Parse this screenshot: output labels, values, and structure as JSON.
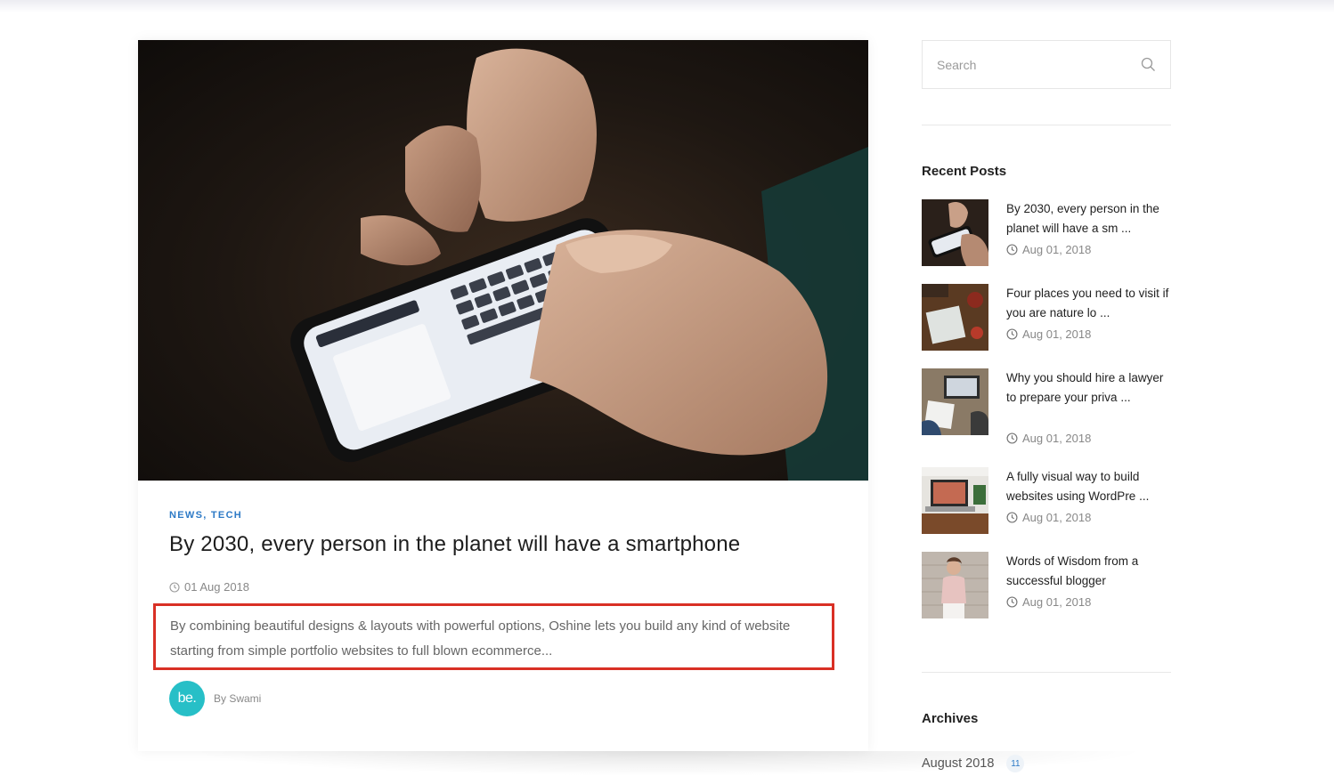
{
  "post": {
    "categories": "NEWS, TECH",
    "title": "By 2030, every person in the planet will have a smartphone",
    "date": "01 Aug 2018",
    "excerpt_line1": "By combining beautiful designs & layouts with powerful options, Oshine lets you build any kind of website",
    "excerpt_line2": "starting from simple portfolio websites to full blown ecommerce...",
    "author_avatar_text": "be.",
    "author": "By Swami",
    "image_icon": "hands-holding-smartphone-photo"
  },
  "sidebar": {
    "search": {
      "placeholder": "Search",
      "value": "",
      "icon": "search-icon"
    },
    "recent_posts_title": "Recent Posts",
    "recent_posts": [
      {
        "title": "By 2030, every person in the planet will have a sm ...",
        "date": "Aug 01, 2018",
        "thumb": "smartphone-photo"
      },
      {
        "title": "Four places you need to visit if you are nature lo ...",
        "date": "Aug 01, 2018",
        "thumb": "map-table-photo"
      },
      {
        "title": "Why you should hire a lawyer to prepare your priva ...",
        "date": "Aug 01, 2018",
        "thumb": "desk-laptop-photo"
      },
      {
        "title": "A fully visual way to build websites using WordPre ...",
        "date": "Aug 01, 2018",
        "thumb": "laptop-desk-photo"
      },
      {
        "title": "Words of Wisdom from a successful blogger",
        "date": "Aug 01, 2018",
        "thumb": "woman-portrait-photo"
      }
    ],
    "archives_title": "Archives",
    "archives": [
      {
        "label": "August 2018",
        "count": "11"
      }
    ]
  },
  "colors": {
    "accent": "#2d7ac6",
    "highlight_border": "#d93025",
    "avatar": "#27bfc7"
  }
}
